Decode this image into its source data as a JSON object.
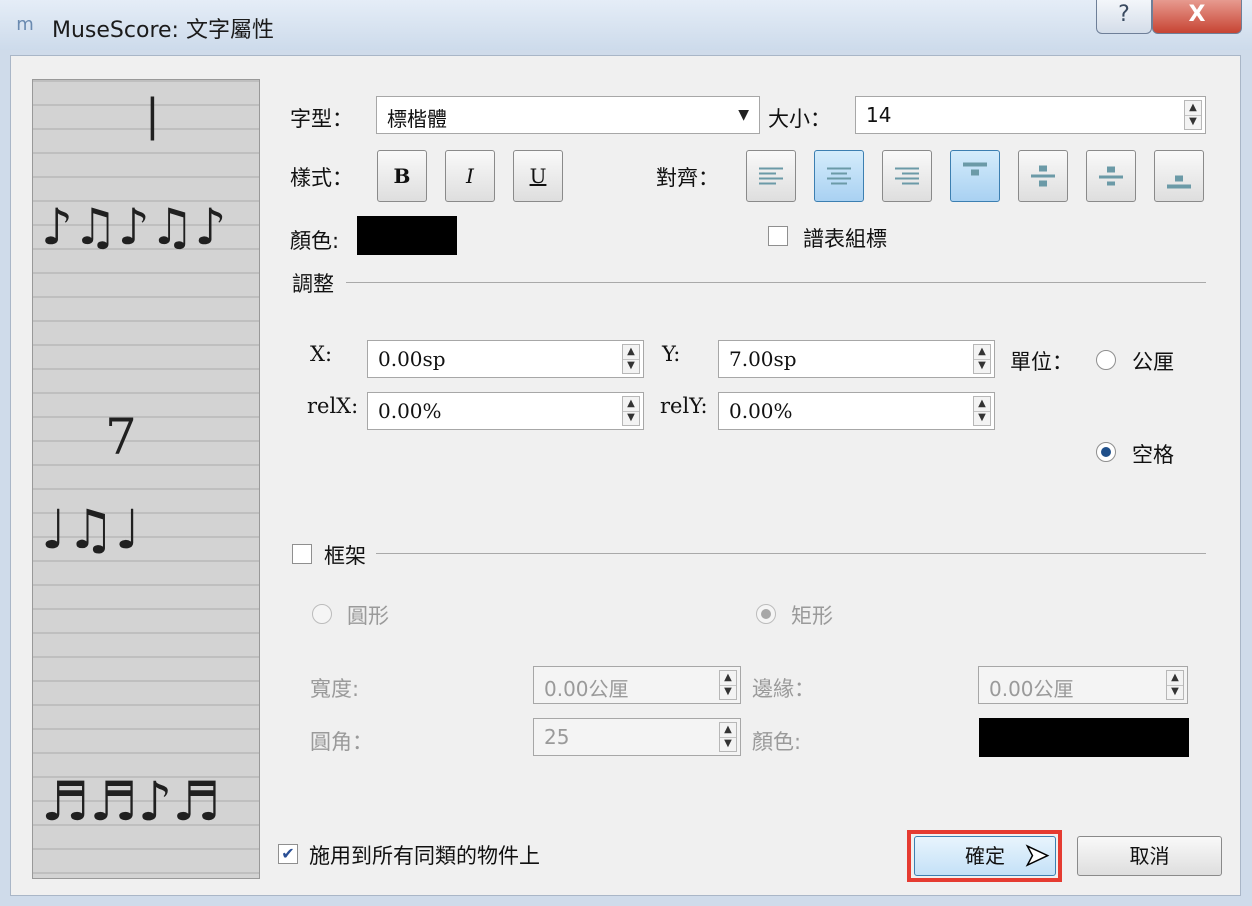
{
  "window": {
    "title": "MuseScore: 文字屬性",
    "help_icon": "?",
    "close_icon": "X"
  },
  "font": {
    "label": "字型：",
    "value": "標楷體",
    "size_label": "大小：",
    "size_value": "14"
  },
  "style": {
    "label": "樣式：",
    "bold": "B",
    "italic": "I",
    "underline": "U",
    "align_label": "對齊："
  },
  "color": {
    "label": "顏色:",
    "value": "#000000"
  },
  "system_flag": {
    "label": "譜表組標",
    "checked": false
  },
  "offset": {
    "section_label": "調整",
    "x_label": "X:",
    "x_value": "0.00sp",
    "y_label": "Y:",
    "y_value": "7.00sp",
    "relx_label": "relX:",
    "relx_value": "0.00%",
    "rely_label": "relY:",
    "rely_value": "0.00%",
    "unit_label": "單位：",
    "unit_mm": "公厘",
    "unit_space": "空格",
    "selected_unit": "空格"
  },
  "frame": {
    "label": "框架",
    "checked": false,
    "circle": "圓形",
    "box": "矩形",
    "width_label": "寬度:",
    "width_value": "0.00公厘",
    "margin_label": "邊緣：",
    "margin_value": "0.00公厘",
    "round_label": "圓角：",
    "round_value": "25",
    "color_label": "顏色:",
    "color_value": "#000000"
  },
  "apply_all": {
    "label": "施用到所有同類的物件上",
    "checked": true
  },
  "buttons": {
    "ok": "確定",
    "cancel": "取消"
  }
}
